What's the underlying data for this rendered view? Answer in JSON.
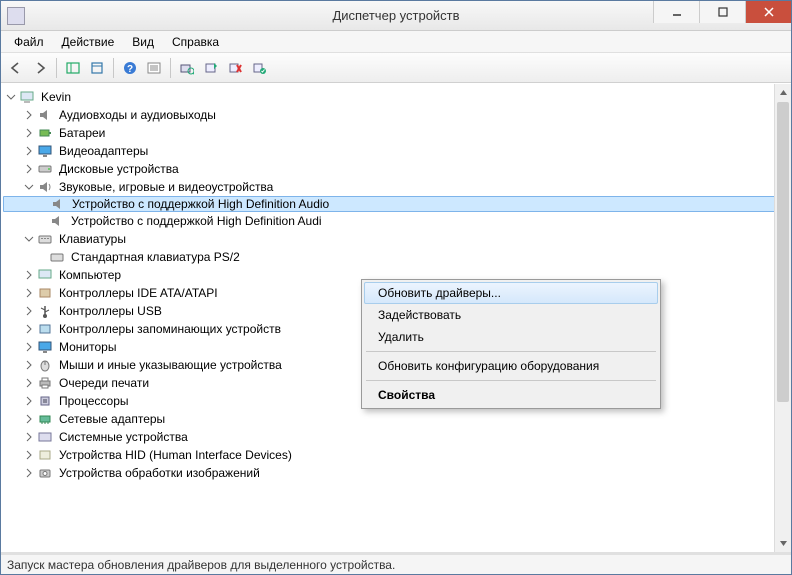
{
  "window": {
    "title": "Диспетчер устройств"
  },
  "menu": {
    "file": "Файл",
    "action": "Действие",
    "view": "Вид",
    "help": "Справка"
  },
  "tree": {
    "root": "Kevin",
    "items": [
      {
        "label": "Аудиовходы и аудиовыходы",
        "expanded": false
      },
      {
        "label": "Батареи",
        "expanded": false
      },
      {
        "label": "Видеоадаптеры",
        "expanded": false
      },
      {
        "label": "Дисковые устройства",
        "expanded": false
      },
      {
        "label": "Звуковые, игровые и видеоустройства",
        "expanded": true,
        "children": [
          {
            "label": "Устройство с поддержкой High Definition Audio",
            "selected": true
          },
          {
            "label": "Устройство с поддержкой High Definition Audi"
          }
        ]
      },
      {
        "label": "Клавиатуры",
        "expanded": true,
        "children": [
          {
            "label": "Стандартная клавиатура PS/2"
          }
        ]
      },
      {
        "label": "Компьютер",
        "expanded": false
      },
      {
        "label": "Контроллеры IDE ATA/ATAPI",
        "expanded": false
      },
      {
        "label": "Контроллеры USB",
        "expanded": false
      },
      {
        "label": "Контроллеры запоминающих устройств",
        "expanded": false
      },
      {
        "label": "Мониторы",
        "expanded": false
      },
      {
        "label": "Мыши и иные указывающие устройства",
        "expanded": false
      },
      {
        "label": "Очереди печати",
        "expanded": false
      },
      {
        "label": "Процессоры",
        "expanded": false
      },
      {
        "label": "Сетевые адаптеры",
        "expanded": false
      },
      {
        "label": "Системные устройства",
        "expanded": false
      },
      {
        "label": "Устройства HID (Human Interface Devices)",
        "expanded": false
      },
      {
        "label": "Устройства обработки изображений",
        "expanded": false
      }
    ]
  },
  "context_menu": {
    "update_drivers": "Обновить драйверы...",
    "enable": "Задействовать",
    "delete": "Удалить",
    "scan": "Обновить конфигурацию оборудования",
    "properties": "Свойства"
  },
  "statusbar": {
    "text": "Запуск мастера обновления драйверов для выделенного устройства."
  }
}
